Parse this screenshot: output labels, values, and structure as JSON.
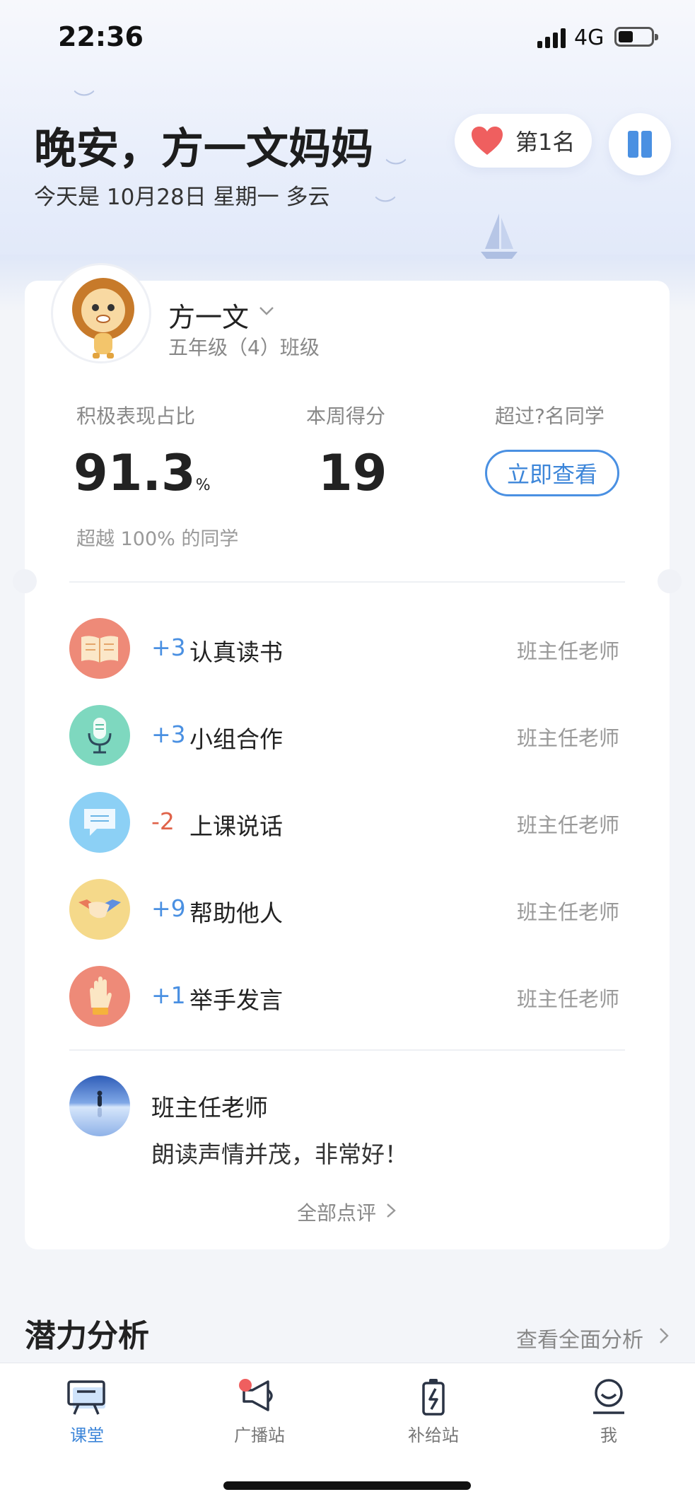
{
  "status_bar": {
    "time": "22:36",
    "network": "4G"
  },
  "header": {
    "greeting": "晚安，方一文妈妈",
    "date_line": "今天是 10月28日 星期一 多云",
    "rank_label": "第1名"
  },
  "student": {
    "name": "方一文",
    "class": "五年级（4）班级"
  },
  "stats": {
    "positive_label": "积极表现占比",
    "positive_value": "91.3",
    "positive_unit": "%",
    "weekly_label": "本周得分",
    "weekly_value": "19",
    "exceed_label": "超过?名同学",
    "view_button": "立即查看",
    "exceed_text": "超越 100% 的同学"
  },
  "records": [
    {
      "score": "+3",
      "label": "认真读书",
      "teacher": "班主任老师",
      "icon": "book-icon",
      "color": "#ee8a78"
    },
    {
      "score": "+3",
      "label": "小组合作",
      "teacher": "班主任老师",
      "icon": "microphone-icon",
      "color": "#7ed8bf"
    },
    {
      "score": "-2",
      "label": "上课说话",
      "teacher": "班主任老师",
      "icon": "chat-bubble-icon",
      "color": "#8cd0f5"
    },
    {
      "score": "+9",
      "label": "帮助他人",
      "teacher": "班主任老师",
      "icon": "handshake-icon",
      "color": "#f5d98a"
    },
    {
      "score": "+1",
      "label": "举手发言",
      "teacher": "班主任老师",
      "icon": "raised-hand-icon",
      "color": "#ee8a78"
    }
  ],
  "comment": {
    "teacher": "班主任老师",
    "text": "朗读声情并茂，非常好！",
    "all_link": "全部点评"
  },
  "potential": {
    "title": "潜力分析",
    "link": "查看全面分析"
  },
  "tabs": [
    {
      "label": "课堂",
      "icon": "classroom-icon",
      "active": true
    },
    {
      "label": "广播站",
      "icon": "megaphone-icon",
      "active": false
    },
    {
      "label": "补给站",
      "icon": "battery-charge-icon",
      "active": false
    },
    {
      "label": "我",
      "icon": "profile-icon",
      "active": false
    }
  ],
  "colors": {
    "accent": "#3d86d9",
    "positive": "#4a90e2",
    "negative": "#e0634a",
    "heart": "#ef5f5f"
  }
}
